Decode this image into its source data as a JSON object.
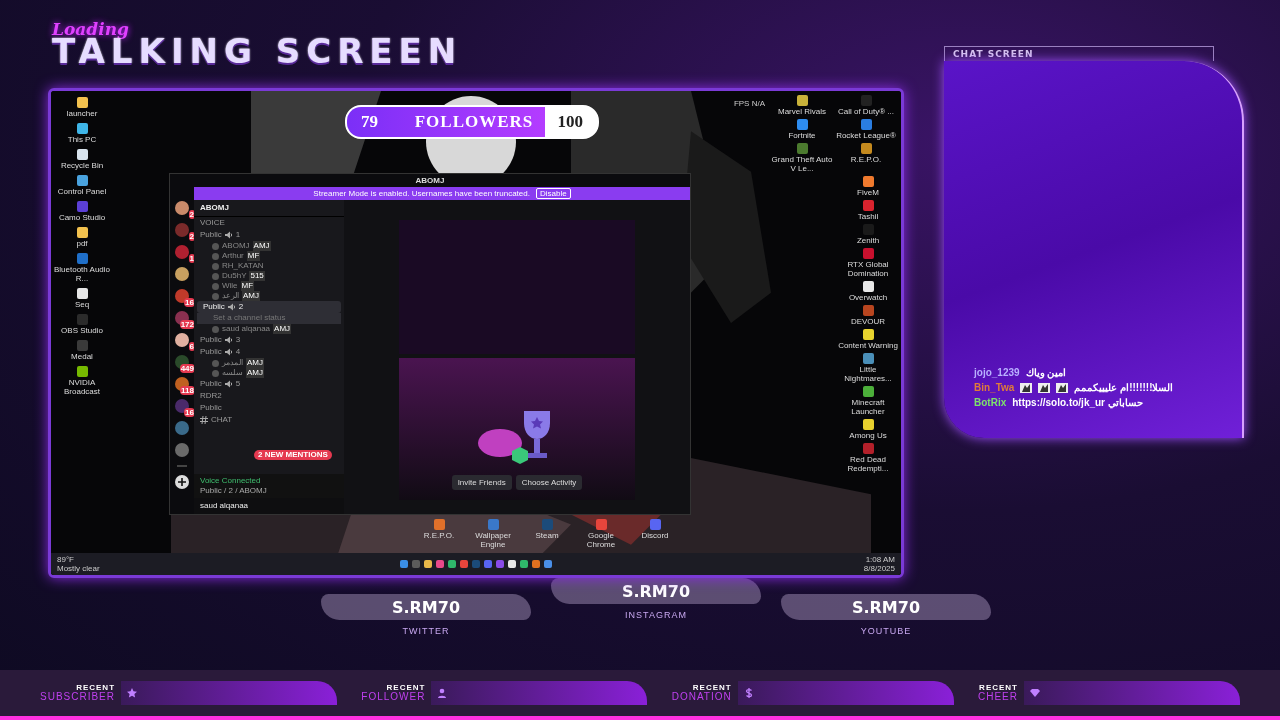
{
  "overlay": {
    "tag": "Loading",
    "title": "TALKING SCREEN"
  },
  "desktop": {
    "followers_goal": {
      "current": "79",
      "label": "FOLLOWERS",
      "goal": "100",
      "level": 0.79
    },
    "fps": "FPS N/A",
    "left_icons": [
      {
        "label": "launcher",
        "color": "#f2c14e"
      },
      {
        "label": "This PC",
        "color": "#3fb6e8"
      },
      {
        "label": "Recycle Bin",
        "color": "#d9e4ee"
      },
      {
        "label": "Control Panel",
        "color": "#4aa3df"
      },
      {
        "label": "Camo Studio",
        "color": "#5b3fd6"
      },
      {
        "label": "pdf",
        "color": "#f2c14e"
      },
      {
        "label": "Bluetooth Audio R...",
        "color": "#1f6fc9"
      },
      {
        "label": "Seq",
        "color": "#e6e6e6"
      },
      {
        "label": "OBS Studio",
        "color": "#2b2b2b"
      },
      {
        "label": "Medal",
        "color": "#3a3a3a"
      },
      {
        "label": "NVIDIA Broadcast",
        "color": "#76b900"
      }
    ],
    "right_icons_top": [
      {
        "label": "Marvel Rivals",
        "color": "#c9b23a"
      },
      {
        "label": "Call of Duty® ...",
        "color": "#222222"
      },
      {
        "label": "Fortnite",
        "color": "#2d8cf0"
      },
      {
        "label": "Rocket League®",
        "color": "#2a7de1"
      },
      {
        "label": "Grand Theft Auto V Le...",
        "color": "#4b7a2e"
      },
      {
        "label": "R.E.P.O.",
        "color": "#c58a1e"
      }
    ],
    "right_icons": [
      {
        "label": "FiveM",
        "color": "#f07a2e"
      },
      {
        "label": "Tashil",
        "color": "#d9232e"
      },
      {
        "label": "Zenith",
        "color": "#1a1a1a"
      },
      {
        "label": "RTX Global Domination",
        "color": "#c8102e"
      },
      {
        "label": "Overwatch",
        "color": "#e8e8e8"
      },
      {
        "label": "DEVOUR",
        "color": "#b8451f"
      },
      {
        "label": "Content Warning",
        "color": "#e8d32e"
      },
      {
        "label": "Little Nightmares...",
        "color": "#4a8fb8"
      },
      {
        "label": "Minecraft Launcher",
        "color": "#4caf3a"
      },
      {
        "label": "Among Us",
        "color": "#e8d02e"
      },
      {
        "label": "Red Dead Redempti...",
        "color": "#b3202a"
      }
    ],
    "dock_icons": [
      {
        "label": "R.E.P.O.",
        "color": "#e0702a"
      },
      {
        "label": "Wallpaper Engine",
        "color": "#3a78c9"
      },
      {
        "label": "Steam",
        "color": "#1b4b7a"
      },
      {
        "label": "Google Chrome",
        "color": "#e8453c"
      },
      {
        "label": "Discord",
        "color": "#5865f2"
      }
    ],
    "taskbar": {
      "temp": "89°F",
      "weather": "Mostly clear",
      "time": "1:08 AM",
      "date": "8/8/2025",
      "apps": [
        {
          "color": "#3a8ee6"
        },
        {
          "color": "#5b5b5b"
        },
        {
          "color": "#e8b84a"
        },
        {
          "color": "#e84a8a"
        },
        {
          "color": "#2fb86b"
        },
        {
          "color": "#e8453c"
        },
        {
          "color": "#1b4b7a"
        },
        {
          "color": "#5865f2"
        },
        {
          "color": "#8a4be8"
        },
        {
          "color": "#e8e8e8"
        },
        {
          "color": "#2fb86b"
        },
        {
          "color": "#e07020"
        },
        {
          "color": "#4a8fe8"
        }
      ]
    }
  },
  "discord": {
    "title": "ABOMJ",
    "banner": "Streamer Mode is enabled. Usernames have been truncated.",
    "banner_button": "Disable",
    "servers": [
      {
        "kind": "server",
        "badge": "2"
      },
      {
        "kind": "server",
        "badge": "2"
      },
      {
        "kind": "server",
        "badge": "1"
      },
      {
        "kind": "server"
      },
      {
        "kind": "server",
        "badge": "16"
      },
      {
        "kind": "server",
        "badge": "172"
      },
      {
        "kind": "server",
        "badge": "6"
      },
      {
        "kind": "server",
        "badge": "449"
      },
      {
        "kind": "server",
        "badge": "118"
      },
      {
        "kind": "server",
        "badge": "16"
      },
      {
        "kind": "server"
      },
      {
        "kind": "server"
      },
      {
        "kind": "divider"
      },
      {
        "kind": "add"
      }
    ],
    "server": "ABOMJ",
    "section": "VOICE",
    "channels": [
      {
        "name": "Public",
        "count": "1",
        "selected": false,
        "members": [
          {
            "name": "ABOMJ",
            "tag": "AMJ"
          },
          {
            "name": "Arthur",
            "tag": "MF"
          },
          {
            "name": "RH_KATAN"
          },
          {
            "name": "Du5hY",
            "tag": "515"
          },
          {
            "name": "Wile",
            "tag": "MF"
          },
          {
            "name": "الرعد",
            "tag": "AMJ"
          }
        ]
      },
      {
        "name": "Public",
        "count": "2",
        "selected": true,
        "status": "Set a channel status",
        "members": [
          {
            "name": "saud alqanaa",
            "tag": "AMJ"
          }
        ]
      },
      {
        "name": "Public",
        "count": "3",
        "selected": false
      },
      {
        "name": "Public",
        "count": "4",
        "selected": false,
        "members": [
          {
            "name": "المدمر",
            "tag": "AMJ"
          },
          {
            "name": "سلسه",
            "tag": "AMJ"
          }
        ]
      },
      {
        "name": "Public",
        "count": "5",
        "selected": false
      },
      {
        "name": "RDR2",
        "selected": false
      }
    ],
    "text_section": "Public",
    "text_channel": "CHAT",
    "mentions": "2 NEW MENTIONS",
    "voice_status": "Voice Connected",
    "voice_channel": "Public / 2 / ABOMJ",
    "user": "saud alqanaa",
    "activity_buttons": [
      "Invite Friends",
      "Choose Activity"
    ]
  },
  "chat": {
    "title": "CHAT SCREEN",
    "messages": [
      {
        "user": "jojo_1239",
        "color": "#b9b0ff",
        "text": "امين وياك"
      },
      {
        "user": "Bin_Twa",
        "color": "#e07b39",
        "text": "السلا!!!!!!!ام عليييكممم",
        "emotes": [
          {
            "kind": "emote"
          },
          {
            "kind": "emote"
          },
          {
            "kind": "emote"
          }
        ]
      },
      {
        "user": "BotRix",
        "color": "#7ee36b",
        "text": "حساباتي https://solo.to/jk_ur"
      }
    ]
  },
  "socials": [
    {
      "handle": "S.RM70",
      "platform": "TWITTER"
    },
    {
      "handle": "S.RM70",
      "platform": "INSTAGRAM"
    },
    {
      "handle": "S.RM70",
      "platform": "YOUTUBE"
    }
  ],
  "recent": [
    {
      "label": "RECENT",
      "type": "SUBSCRIBER",
      "kind": "star"
    },
    {
      "label": "RECENT",
      "type": "FOLLOWER",
      "kind": "person"
    },
    {
      "label": "RECENT",
      "type": "DONATION",
      "kind": "dollar"
    },
    {
      "label": "RECENT",
      "type": "CHEER",
      "kind": "gem"
    }
  ]
}
